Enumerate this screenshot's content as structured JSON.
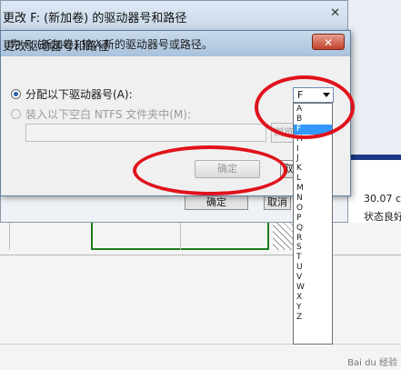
{
  "outer_window": {
    "title": "更改 F: (新加卷) 的驱动器号和路径",
    "close_glyph": "✕",
    "ok_label": "确定",
    "cancel_label": "取消"
  },
  "disk_info": {
    "size": "30.07 c",
    "status": "状态良好"
  },
  "dialog": {
    "title": "更改驱动器号和路径",
    "close_glyph": "✕",
    "prompt": "为 F: (新加卷) 输入新的驱动器号或路径。",
    "option_assign_label": "分配以下驱动器号(A):",
    "option_mount_label": "装入以下空白 NTFS 文件夹中(M):",
    "selected_drive": "F",
    "browse_label": "浏览",
    "ok_label": "确定",
    "cancel_label": "取"
  },
  "drive_letters": [
    "A",
    "B",
    "F",
    "H",
    "I",
    "J",
    "K",
    "L",
    "M",
    "N",
    "O",
    "P",
    "Q",
    "R",
    "S",
    "T",
    "U",
    "V",
    "W",
    "X",
    "Y",
    "Z"
  ],
  "highlighted_index": 2,
  "colors": {
    "annotation_red": "#e0121b",
    "list_highlight": "#3399ff",
    "partition_green": "#1e7a1e"
  },
  "watermark": "Bai du 经验"
}
